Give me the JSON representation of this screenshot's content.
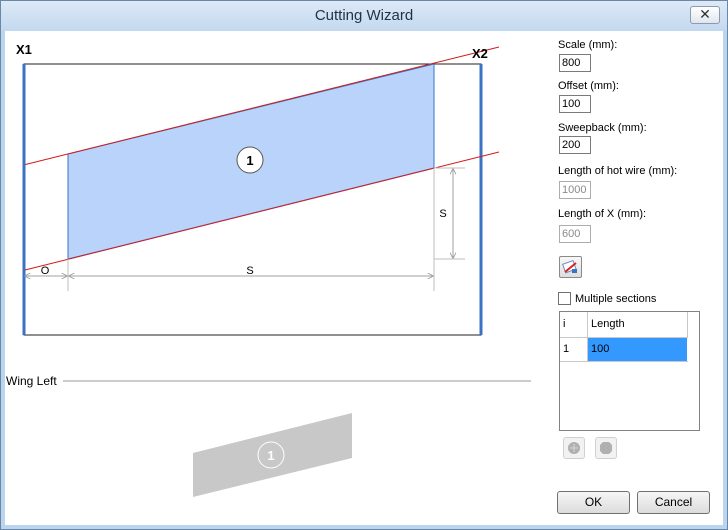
{
  "window": {
    "title": "Cutting Wizard",
    "close_glyph": "✕"
  },
  "diagram": {
    "x1_label": "X1",
    "x2_label": "X2",
    "section_label": "1",
    "offset_dim_label": "O",
    "span_dim_label": "S",
    "sweep_dim_label": "S"
  },
  "preview": {
    "title": "Wing Left",
    "section_label": "1"
  },
  "settings": {
    "scale_label": "Scale (mm):",
    "scale_value": "800",
    "offset_label": "Offset (mm):",
    "offset_value": "100",
    "sweepback_label": "Sweepback (mm):",
    "sweepback_value": "200",
    "hot_wire_label": "Length of hot wire (mm):",
    "hot_wire_value": "1000",
    "length_x_label": "Length of X (mm):",
    "length_x_value": "600",
    "action_icon": "wizard-tool-icon",
    "multiple_label": "Multiple sections",
    "multiple_checked": false
  },
  "sections_table": {
    "col_index": "i",
    "col_length": "Length",
    "rows": [
      {
        "i": "1",
        "length": "100"
      }
    ],
    "add_icon": "add-section-icon",
    "remove_icon": "remove-section-icon"
  },
  "buttons": {
    "ok": "OK",
    "cancel": "Cancel"
  },
  "colors": {
    "frame_blue": "#3a73c4",
    "fill_blue": "#b9d3fb",
    "cut_line_red": "#d21c1c",
    "selection_blue": "#3399ff",
    "preview_gray": "#c8c8c8"
  }
}
